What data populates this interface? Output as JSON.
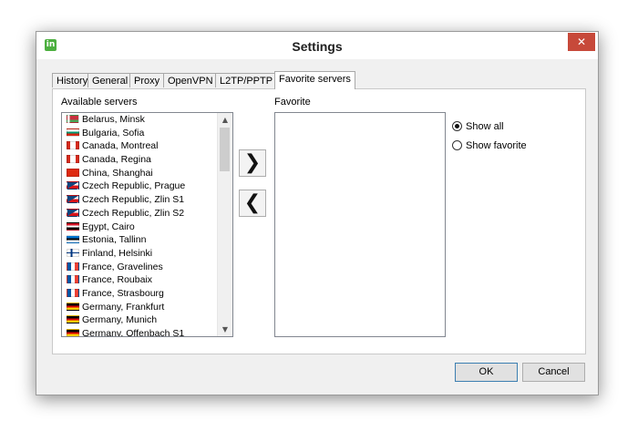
{
  "window": {
    "title": "Settings",
    "app_logo": "in",
    "close_glyph": "✕"
  },
  "tabs": [
    "History",
    "General",
    "Proxy",
    "OpenVPN",
    "L2TP/PPTP",
    "Favorite servers"
  ],
  "active_tab": "Favorite servers",
  "available_label": "Available servers",
  "favorite_label": "Favorite",
  "servers": [
    {
      "label": "Belarus, Minsk",
      "flag": "by"
    },
    {
      "label": "Bulgaria, Sofia",
      "flag": "bg"
    },
    {
      "label": "Canada, Montreal",
      "flag": "ca"
    },
    {
      "label": "Canada, Regina",
      "flag": "ca"
    },
    {
      "label": "China, Shanghai",
      "flag": "cn"
    },
    {
      "label": "Czech Republic, Prague",
      "flag": "cz"
    },
    {
      "label": "Czech Republic, Zlin S1",
      "flag": "cz"
    },
    {
      "label": "Czech Republic, Zlin S2",
      "flag": "cz"
    },
    {
      "label": "Egypt, Cairo",
      "flag": "eg"
    },
    {
      "label": "Estonia, Tallinn",
      "flag": "ee"
    },
    {
      "label": "Finland, Helsinki",
      "flag": "fi"
    },
    {
      "label": "France, Gravelines",
      "flag": "fr"
    },
    {
      "label": "France, Roubaix",
      "flag": "fr"
    },
    {
      "label": "France, Strasbourg",
      "flag": "fr"
    },
    {
      "label": "Germany, Frankfurt",
      "flag": "de"
    },
    {
      "label": "Germany, Munich",
      "flag": "de"
    },
    {
      "label": "Germany, Offenbach S1",
      "flag": "de"
    }
  ],
  "add_button_glyph": "❯",
  "remove_button_glyph": "❮",
  "scroll_up_glyph": "▲",
  "scroll_down_glyph": "▼",
  "radios": [
    {
      "label": "Show all",
      "checked": true
    },
    {
      "label": "Show favorite",
      "checked": false
    }
  ],
  "ok_label": "OK",
  "cancel_label": "Cancel",
  "colors": {
    "close_button": "#c7493a",
    "logo": "#4caf3f",
    "default_button_border": "#3c7fb1"
  }
}
